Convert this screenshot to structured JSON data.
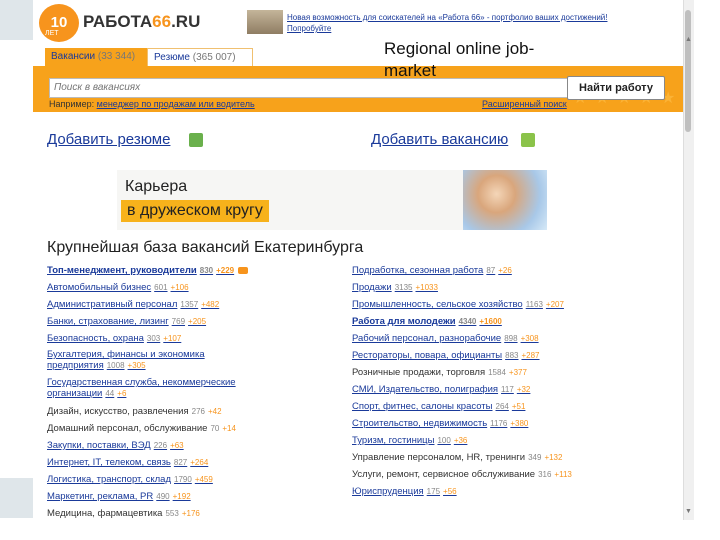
{
  "slide_caption": "Regional online job-market",
  "header": {
    "logo_badge": "10",
    "logo_badge_sub": "ЛЕТ",
    "logo_text_main": "РАБОТА",
    "logo_text_num": "66",
    "logo_text_tld": ".RU",
    "news_link": "Новая возможность для соискателей на «Работа 66» - портфолио ваших достижений! Попробуйте"
  },
  "tabs": [
    {
      "label": "Вакансии",
      "count": "(33 344)"
    },
    {
      "label": "Резюме",
      "count": "(365 007)"
    }
  ],
  "search": {
    "placeholder": "Поиск в вакансиях",
    "button": "Найти работу",
    "example_prefix": "Например:",
    "example_link": "менеджер по продажам или водитель",
    "advanced": "Расширенный поиск"
  },
  "add_resume": "Добавить резюме",
  "add_vacancy": "Добавить вакансию",
  "banner": {
    "line1": "Карьера",
    "line2": "в дружеском кругу"
  },
  "section_title": "Крупнейшая база вакансий Екатеринбурга",
  "left_categories": [
    {
      "label": "Топ-менеджмент, руководители",
      "count": "830",
      "new": "+229",
      "bold": true
    },
    {
      "label": "Автомобильный бизнес",
      "count": "601",
      "new": "+106"
    },
    {
      "label": "Административный персонал",
      "count": "1357",
      "new": "+482"
    },
    {
      "label": "Банки, страхование, лизинг",
      "count": "769",
      "new": "+205"
    },
    {
      "label": "Безопасность, охрана",
      "count": "303",
      "new": "+107"
    },
    {
      "label": "Бухгалтерия, финансы и экономика предприятия",
      "count": "1008",
      "new": "+305"
    },
    {
      "label": "Государственная служба, некоммерческие организации",
      "count": "44",
      "new": "+6"
    },
    {
      "label": "Дизайн, искусство, развлечения",
      "count": "276",
      "new": "+42",
      "plain": true
    },
    {
      "label": "Домашний персонал, обслуживание",
      "count": "70",
      "new": "+14",
      "plain": true
    },
    {
      "label": "Закупки, поставки, ВЭД",
      "count": "226",
      "new": "+63"
    },
    {
      "label": "Интернет, IT, телеком, связь",
      "count": "827",
      "new": "+264"
    },
    {
      "label": "Логистика, транспорт, склад",
      "count": "1790",
      "new": "+459"
    },
    {
      "label": "Маркетинг, реклама, PR",
      "count": "490",
      "new": "+192"
    },
    {
      "label": "Медицина, фармацевтика",
      "count": "553",
      "new": "+176",
      "plain": true
    }
  ],
  "right_categories": [
    {
      "label": "Подработка, сезонная работа",
      "count": "87",
      "new": "+26"
    },
    {
      "label": "Продажи",
      "count": "3135",
      "new": "+1033"
    },
    {
      "label": "Промышленность, сельское хозяйство",
      "count": "1163",
      "new": "+207"
    },
    {
      "label": "Работа для молодежи",
      "count": "4340",
      "new": "+1600",
      "bold": true
    },
    {
      "label": "Рабочий персонал, разнорабочие",
      "count": "898",
      "new": "+308"
    },
    {
      "label": "Рестораторы, повара, официанты",
      "count": "883",
      "new": "+287"
    },
    {
      "label": "Розничные продажи, торговля",
      "count": "1584",
      "new": "+377",
      "plain": true
    },
    {
      "label": "СМИ, Издательство, полиграфия",
      "count": "117",
      "new": "+32"
    },
    {
      "label": "Спорт, фитнес, салоны красоты",
      "count": "264",
      "new": "+51"
    },
    {
      "label": "Строительство, недвижимость",
      "count": "1176",
      "new": "+380"
    },
    {
      "label": "Туризм, гостиницы",
      "count": "100",
      "new": "+36"
    },
    {
      "label": "Управление персоналом, HR, тренинги",
      "count": "349",
      "new": "+132",
      "plain": true
    },
    {
      "label": "Услуги, ремонт, сервисное обслуживание",
      "count": "316",
      "new": "+113",
      "plain": true
    },
    {
      "label": "Юриспруденция",
      "count": "175",
      "new": "+56"
    }
  ]
}
